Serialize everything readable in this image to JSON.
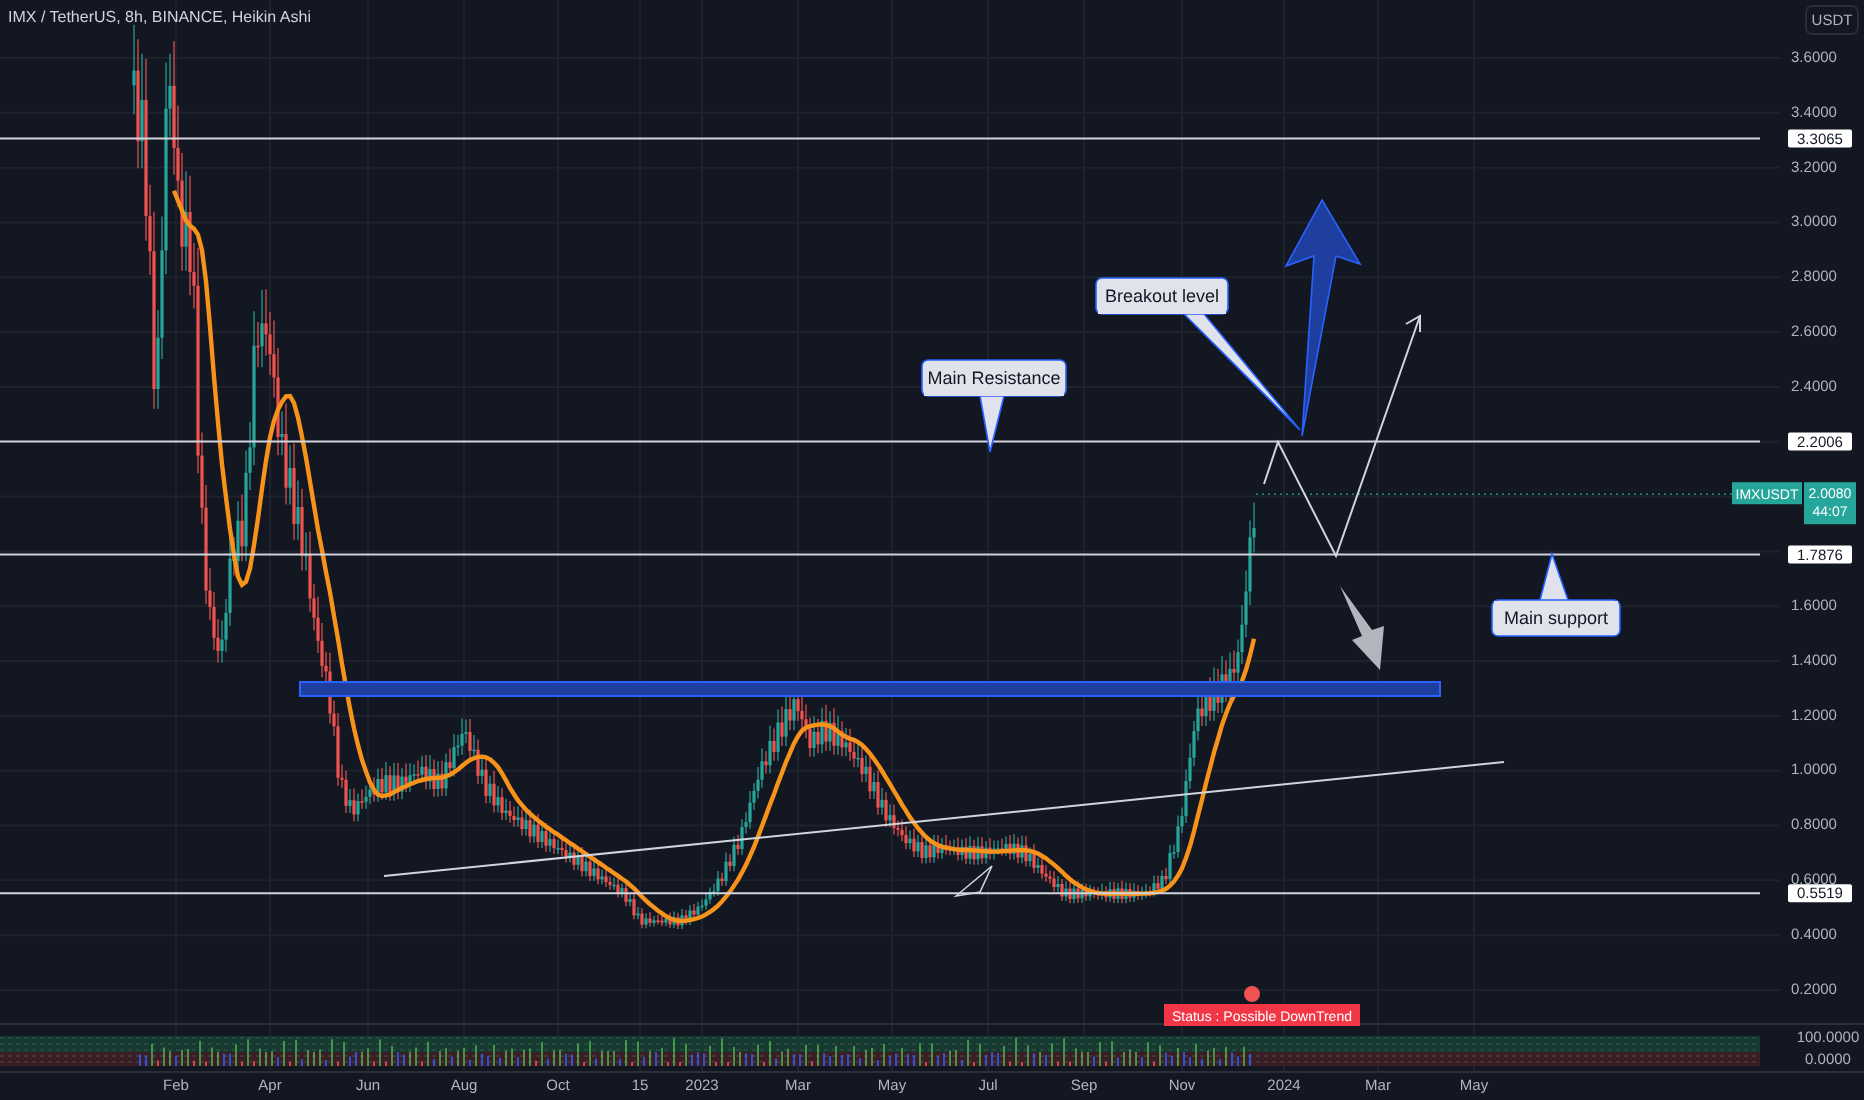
{
  "header": {
    "title": "IMX / TetherUS, 8h, BINANCE, Heikin Ashi",
    "currency": "USDT"
  },
  "price_axis": {
    "ticks": [
      "3.6000",
      "3.4000",
      "3.2000",
      "3.0000",
      "2.8000",
      "2.6000",
      "2.4000",
      "1.6000",
      "1.4000",
      "1.2000",
      "1.0000",
      "0.8000",
      "0.6000",
      "0.4000",
      "0.2000"
    ]
  },
  "levels": [
    {
      "price": "3.3065"
    },
    {
      "price": "2.2006"
    },
    {
      "price": "1.7876"
    },
    {
      "price": "0.5519"
    }
  ],
  "last_price": {
    "symbol": "IMXUSDT",
    "price": "2.0080",
    "countdown": "44:07"
  },
  "callouts": [
    {
      "text": "Breakout level"
    },
    {
      "text": "Main Resistance"
    },
    {
      "text": "Main support"
    }
  ],
  "indicator": {
    "status": "Status :  Possible DownTrend",
    "axis": [
      "100.0000",
      "0.0000"
    ]
  },
  "time_axis": [
    "Feb",
    "Apr",
    "Jun",
    "Aug",
    "Oct",
    "15",
    "2023",
    "Mar",
    "May",
    "Jul",
    "Sep",
    "Nov",
    "2024",
    "Mar",
    "May"
  ]
}
